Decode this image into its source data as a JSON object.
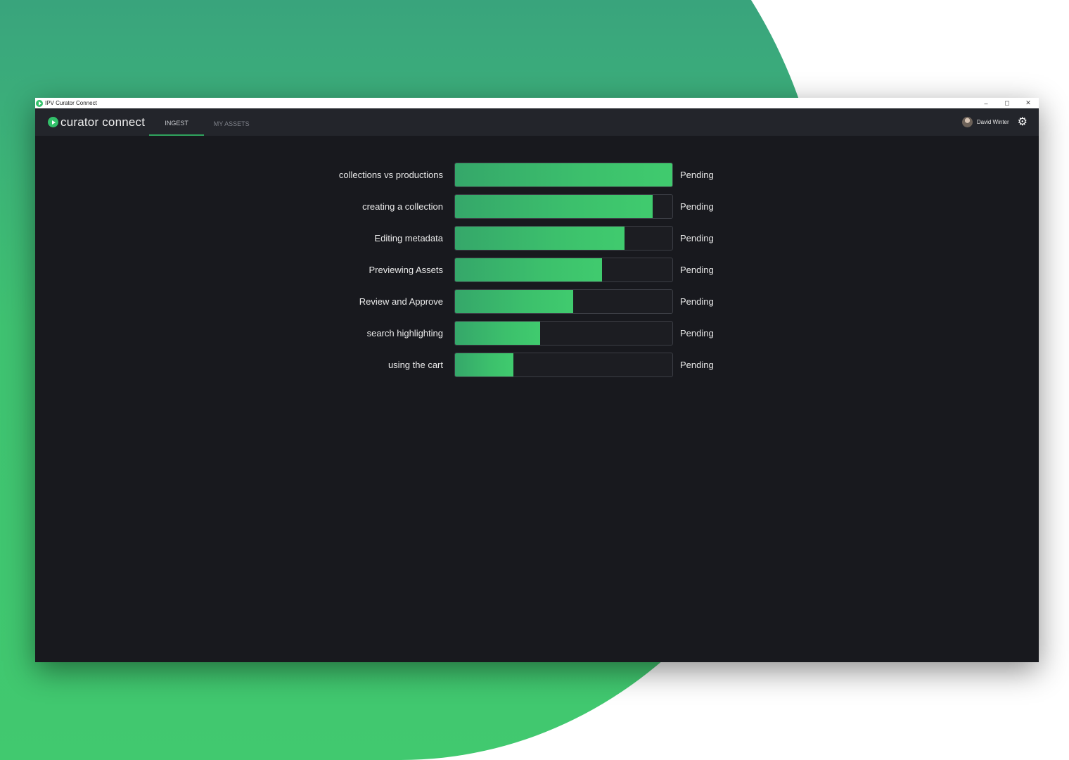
{
  "window": {
    "title": "IPV Curator Connect"
  },
  "window_controls": {
    "minimize": "–",
    "maximize": "◻",
    "close": "✕"
  },
  "appbar": {
    "logo_text": "curator connect",
    "tabs": [
      {
        "label": "INGEST",
        "active": true
      },
      {
        "label": "MY ASSETS",
        "active": false
      }
    ],
    "user_name": "David Winter",
    "settings_icon": "gear-icon"
  },
  "colors": {
    "accent": "#32c06a",
    "window_bg": "#18191e",
    "appbar_bg": "#23252b"
  },
  "uploads": [
    {
      "name": "collections vs productions",
      "status": "Pending",
      "progress": 1.0
    },
    {
      "name": "creating a collection",
      "status": "Pending",
      "progress": 0.91
    },
    {
      "name": "Editing metadata",
      "status": "Pending",
      "progress": 0.78
    },
    {
      "name": "Previewing Assets",
      "status": "Pending",
      "progress": 0.675
    },
    {
      "name": "Review and Approve",
      "status": "Pending",
      "progress": 0.545
    },
    {
      "name": "search highlighting",
      "status": "Pending",
      "progress": 0.39
    },
    {
      "name": "using the cart",
      "status": "Pending",
      "progress": 0.27
    }
  ]
}
